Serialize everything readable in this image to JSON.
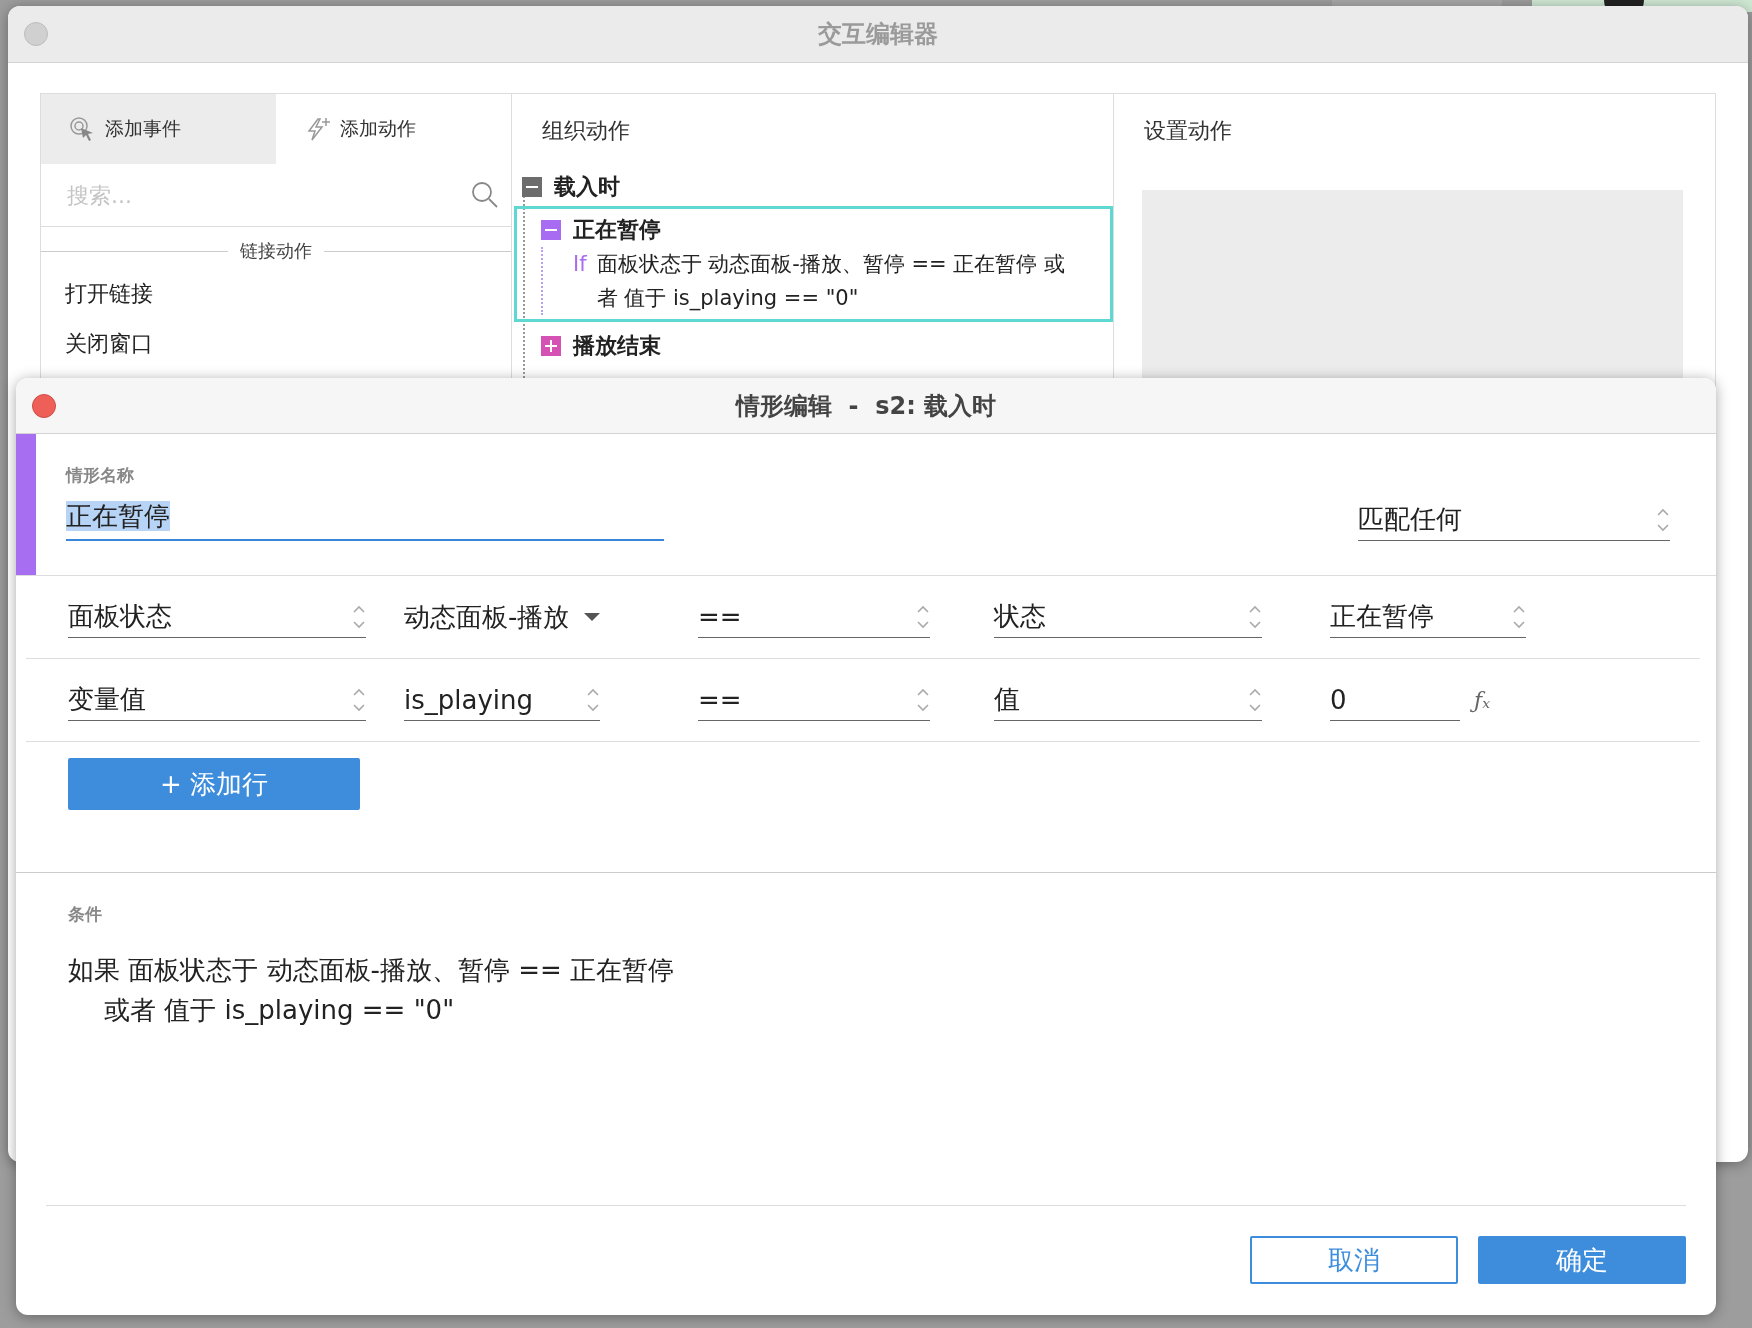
{
  "back_window": {
    "title": "交互编辑器",
    "tabs": [
      {
        "label": "添加事件",
        "selected": true,
        "kind": "event"
      },
      {
        "label": "添加动作",
        "selected": false,
        "kind": "action"
      }
    ],
    "search": {
      "placeholder": "搜索..."
    },
    "action_group": {
      "title": "链接动作",
      "items": [
        "打开链接",
        "关闭窗口"
      ]
    },
    "organize": {
      "title": "组织动作",
      "tree": [
        {
          "label": "载入时",
          "expanded": true,
          "children": [
            {
              "label": "正在暂停",
              "expanded": true,
              "selected": true,
              "color": "#a86cf2",
              "keyword": "If",
              "condition": "面板状态于 动态面板-播放、暂停 == 正在暂停 或者 值于 is_playing == \"0\""
            },
            {
              "label": "播放结束",
              "expanded": false,
              "selected": false,
              "color": "#d552b4"
            }
          ]
        }
      ]
    },
    "settings": {
      "title": "设置动作"
    }
  },
  "dialog": {
    "title": "情形编辑  -  s2: 载入时",
    "case_name_label": "情形名称",
    "case_name": "正在暂停",
    "case_name_highlighted": true,
    "match": "匹配任何",
    "rows": [
      {
        "fields": [
          {
            "kind": "select",
            "value": "面板状态"
          },
          {
            "kind": "dropdown",
            "value": "动态面板-播放"
          },
          {
            "kind": "select",
            "value": "=="
          },
          {
            "kind": "select",
            "value": "状态"
          },
          {
            "kind": "select",
            "value": "正在暂停"
          }
        ]
      },
      {
        "fields": [
          {
            "kind": "select",
            "value": "变量值"
          },
          {
            "kind": "select",
            "value": "is_playing"
          },
          {
            "kind": "select",
            "value": "=="
          },
          {
            "kind": "select",
            "value": "值"
          },
          {
            "kind": "input",
            "value": "0",
            "formula": "ƒₓ"
          }
        ]
      }
    ],
    "add_row_button": "+ 添加行",
    "condition_label": "条件",
    "condition_lines": [
      "如果  面板状态于 动态面板-播放、暂停 == 正在暂停",
      "或者 值于 is_playing == \"0\""
    ],
    "buttons": [
      {
        "label": "取消",
        "kind": "secondary"
      },
      {
        "label": "确定",
        "kind": "primary"
      }
    ]
  }
}
